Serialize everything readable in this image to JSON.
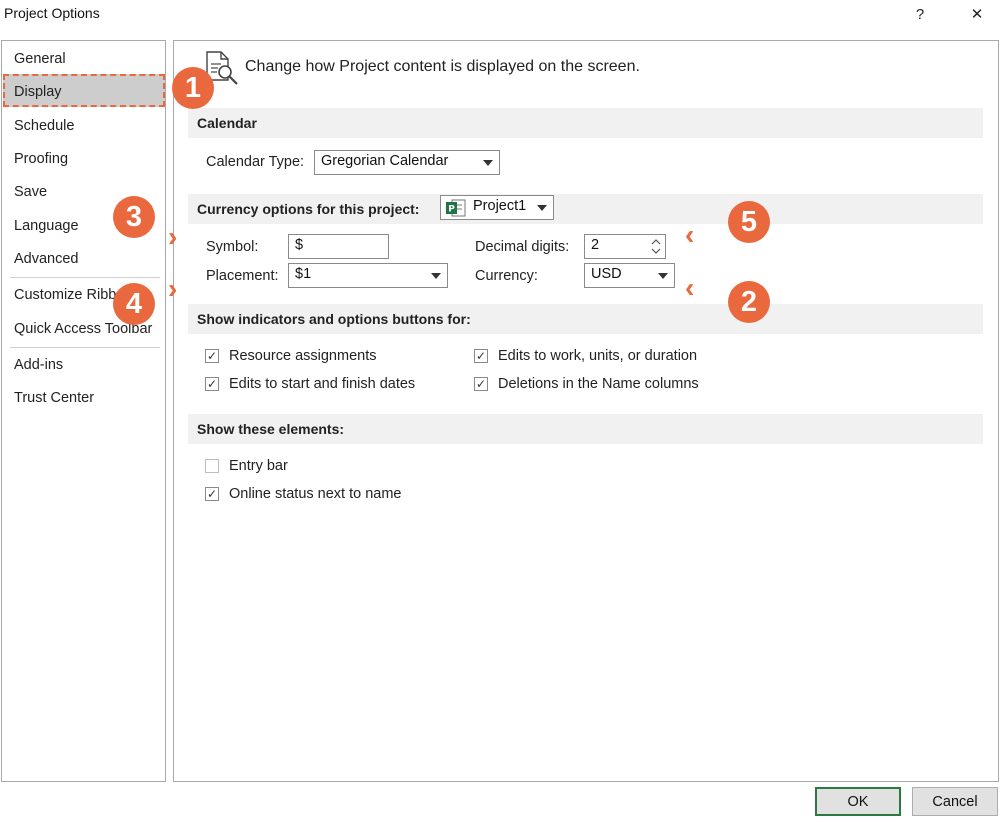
{
  "window": {
    "title": "Project Options",
    "help_label": "?",
    "close_label": "✕"
  },
  "sidebar": {
    "items": [
      {
        "label": "General"
      },
      {
        "label": "Display"
      },
      {
        "label": "Schedule"
      },
      {
        "label": "Proofing"
      },
      {
        "label": "Save"
      },
      {
        "label": "Language"
      },
      {
        "label": "Advanced"
      },
      {
        "label": "Customize Ribbon"
      },
      {
        "label": "Quick Access Toolbar"
      },
      {
        "label": "Add-ins"
      },
      {
        "label": "Trust Center"
      }
    ],
    "selected": "Display"
  },
  "main": {
    "header": "Change how Project content is displayed on the screen.",
    "calendar": {
      "section_title": "Calendar",
      "type_label": "Calendar Type:",
      "type_value": "Gregorian Calendar"
    },
    "currency": {
      "section_title": "Currency options for this project:",
      "project_value": "Project1",
      "symbol_label": "Symbol:",
      "symbol_value": "$",
      "placement_label": "Placement:",
      "placement_value": "$1",
      "decimal_label": "Decimal digits:",
      "decimal_value": "2",
      "currency_label": "Currency:",
      "currency_value": "USD"
    },
    "indicators": {
      "section_title": "Show indicators and options buttons for:",
      "options": [
        {
          "label": "Resource assignments",
          "checked": true
        },
        {
          "label": "Edits to work, units, or duration",
          "checked": true
        },
        {
          "label": "Edits to start and finish dates",
          "checked": true
        },
        {
          "label": "Deletions in the Name columns",
          "checked": true
        }
      ]
    },
    "elements": {
      "section_title": "Show these elements:",
      "options": [
        {
          "label": "Entry bar",
          "checked": false
        },
        {
          "label": "Online status next to name",
          "checked": true
        }
      ]
    }
  },
  "footer": {
    "ok_label": "OK",
    "cancel_label": "Cancel"
  },
  "annotations": {
    "badges": [
      "1",
      "2",
      "3",
      "4",
      "5"
    ],
    "color": "#e9683d"
  }
}
